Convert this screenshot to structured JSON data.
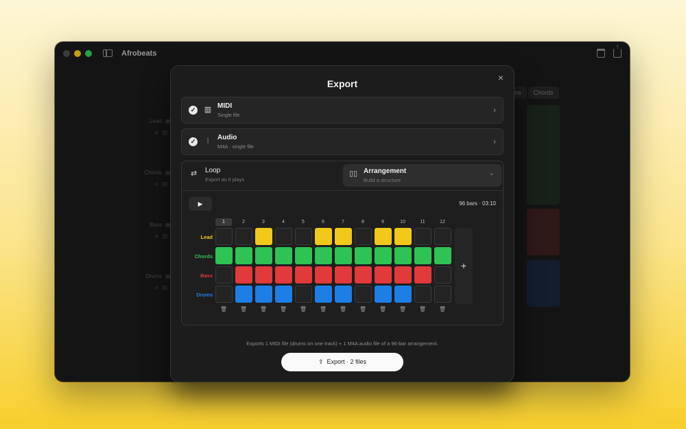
{
  "window": {
    "title": "Afrobeats"
  },
  "background": {
    "tracks": [
      {
        "name": "Lead",
        "mute": "M"
      },
      {
        "name": "Chords",
        "mute": "M"
      },
      {
        "name": "Bass",
        "mute": "M"
      },
      {
        "name": "Drums",
        "mute": "M"
      }
    ],
    "tabs": [
      "ns",
      "Chords"
    ]
  },
  "modal": {
    "title": "Export",
    "close": "×",
    "options": [
      {
        "label": "MIDI",
        "sub": "Single file",
        "icon": "piano-icon",
        "checked": true
      },
      {
        "label": "Audio",
        "sub": "M4A · single file",
        "icon": "waveform-icon",
        "checked": true
      }
    ],
    "segments": {
      "loop": {
        "label": "Loop",
        "sub": "Export as it plays"
      },
      "arrangement": {
        "label": "Arrangement",
        "sub": "Build a structure",
        "selected": true
      }
    },
    "bars_info": "96 bars · 03:10",
    "columns": [
      "1",
      "2",
      "3",
      "4",
      "5",
      "6",
      "7",
      "8",
      "9",
      "10",
      "11",
      "12"
    ],
    "active_column": 0,
    "rows": [
      {
        "label": "Lead",
        "color": "#f2c81a",
        "cells": [
          0,
          0,
          1,
          0,
          0,
          1,
          1,
          0,
          1,
          1,
          0,
          0
        ]
      },
      {
        "label": "Chords",
        "color": "#2fc254",
        "cells": [
          1,
          1,
          1,
          1,
          1,
          1,
          1,
          1,
          1,
          1,
          1,
          1
        ]
      },
      {
        "label": "Bass",
        "color": "#e2393b",
        "cells": [
          0,
          1,
          1,
          1,
          1,
          1,
          1,
          1,
          1,
          1,
          1,
          0
        ]
      },
      {
        "label": "Drums",
        "color": "#1d7ee6",
        "cells": [
          0,
          1,
          1,
          1,
          0,
          1,
          1,
          0,
          1,
          1,
          0,
          0
        ]
      }
    ],
    "summary": "Exports 1 MIDI file (drums on one track) + 1 M4A audio file of a 96-bar arrangement.",
    "export_label": "Export · 2 files"
  }
}
